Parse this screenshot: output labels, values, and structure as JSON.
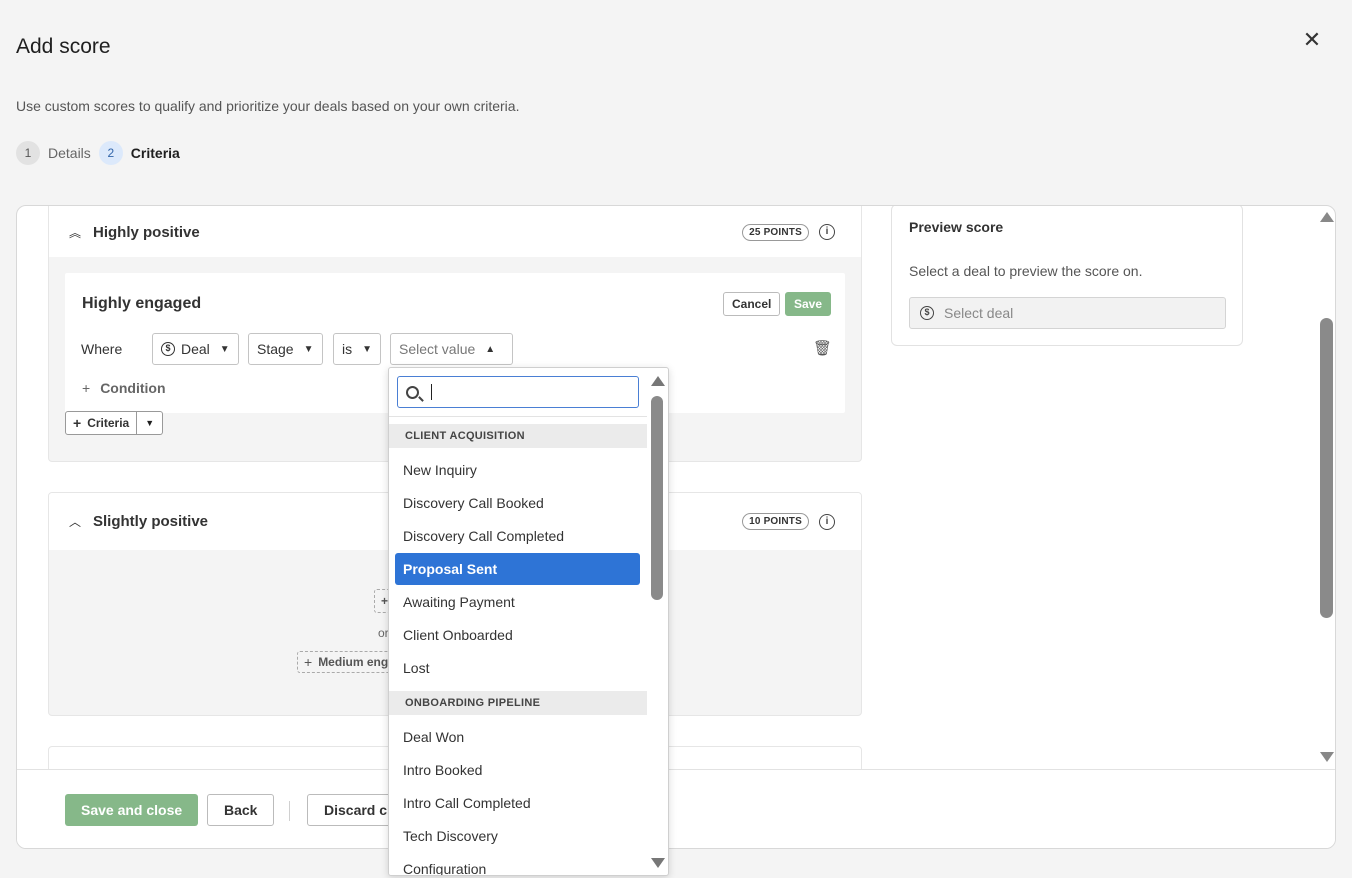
{
  "modal": {
    "title": "Add score",
    "subtitle": "Use custom scores to qualify and prioritize your deals based on your own criteria.",
    "close_icon": "close-icon"
  },
  "steps": [
    {
      "num": "1",
      "label": "Details",
      "active": false
    },
    {
      "num": "2",
      "label": "Criteria",
      "active": true
    }
  ],
  "sections": {
    "highly_positive": {
      "label": "Highly positive",
      "points": "25 POINTS",
      "rule": {
        "title": "Highly engaged",
        "cancel_label": "Cancel",
        "save_label": "Save",
        "where_label": "Where",
        "entity": "Deal",
        "field": "Stage",
        "operator": "is",
        "value_placeholder": "Select value",
        "condition_label": "Condition"
      },
      "criteria_label": "Criteria"
    },
    "slightly_positive": {
      "label": "Slightly positive",
      "points": "10 POINTS",
      "or_label": "or",
      "medium_label": "Medium eng"
    }
  },
  "preview": {
    "title": "Preview score",
    "text": "Select a deal to preview the score on.",
    "placeholder": "Select deal"
  },
  "footer": {
    "save_close_label": "Save and close",
    "back_label": "Back",
    "discard_label": "Discard cl"
  },
  "dropdown": {
    "search_value": "",
    "groups": [
      {
        "name": "CLIENT ACQUISITION",
        "items": [
          "New Inquiry",
          "Discovery Call Booked",
          "Discovery Call Completed",
          "Proposal Sent",
          "Awaiting Payment",
          "Client Onboarded",
          "Lost"
        ]
      },
      {
        "name": "ONBOARDING PIPELINE",
        "items": [
          "Deal Won",
          "Intro Booked",
          "Intro Call Completed",
          "Tech Discovery",
          "Configuration"
        ]
      }
    ],
    "selected": "Proposal Sent"
  },
  "colors": {
    "accent": "#2e74d6",
    "save_green": "#86b889"
  }
}
